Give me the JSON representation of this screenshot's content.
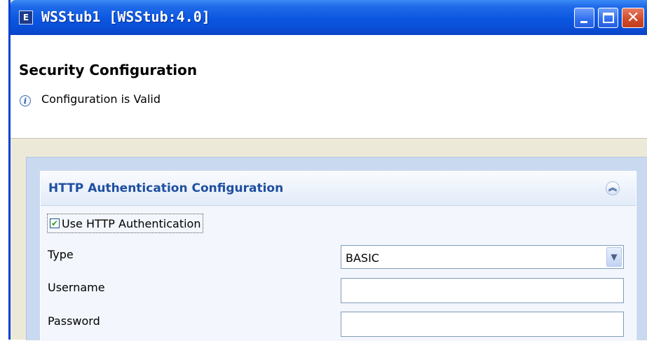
{
  "window": {
    "title": "WSStub1 [WSStub:4.0]",
    "app_icon_glyph": "E",
    "controls": {
      "minimize": "minimize-icon",
      "maximize": "maximize-icon",
      "close": "close-icon"
    }
  },
  "header": {
    "title": "Security Configuration",
    "status_icon": "info-icon",
    "status_text": "Configuration is Valid"
  },
  "section": {
    "title": "HTTP Authentication Configuration",
    "collapse_icon": "chevron-up-double-icon",
    "use_auth": {
      "label": "Use HTTP Authentication",
      "checked": true
    },
    "type": {
      "label": "Type",
      "value": "BASIC"
    },
    "username": {
      "label": "Username",
      "value": ""
    },
    "password": {
      "label": "Password",
      "value": ""
    }
  },
  "colors": {
    "title_bar": "#0b56e0",
    "section_title": "#1f4fa0",
    "form_background": "#c9d9f0",
    "check_mark": "#21a121"
  }
}
